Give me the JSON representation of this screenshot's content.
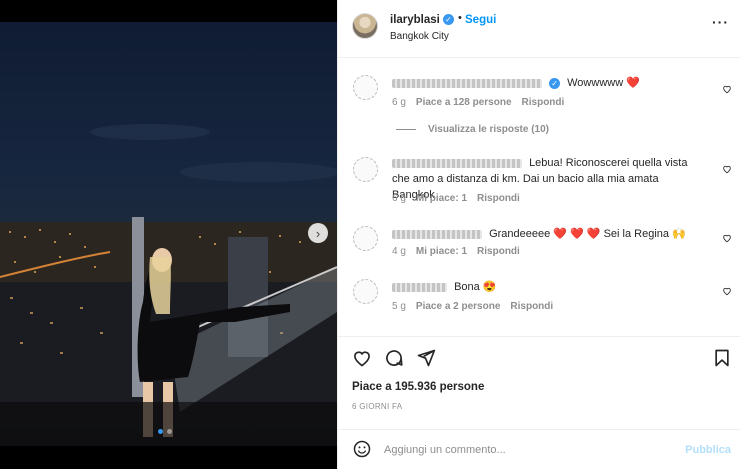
{
  "post": {
    "username": "ilaryblasi",
    "follow_label": "Segui",
    "location": "Bangkok City",
    "more_icon": "more-horizontal-icon",
    "verified_icon": "verified-badge-icon"
  },
  "comments": [
    {
      "text": "Wowwwww",
      "emoji": "❤️",
      "time": "6 g",
      "likes": "Piace a 128 persone",
      "reply": "Rispondi",
      "view_replies": "Visualizza le risposte (10)"
    },
    {
      "text": "Lebua! Riconoscerei quella vista che amo a distanza di km. Dai un bacio alla mia amata Bangkok",
      "time": "6 g",
      "likes": "Mi piace: 1",
      "reply": "Rispondi"
    },
    {
      "text": "Grandeeeee",
      "emoji": "❤️ ❤️ ❤️",
      "text_after": "Sei la Regina",
      "emoji_after": "🙌",
      "time": "4 g",
      "likes": "Mi piace: 1",
      "reply": "Rispondi"
    },
    {
      "text": "Bona",
      "emoji": "😍",
      "time": "5 g",
      "likes": "Piace a 2 persone",
      "reply": "Rispondi"
    }
  ],
  "actions": {
    "like_icon": "heart-icon",
    "comment_icon": "comment-icon",
    "share_icon": "share-icon",
    "save_icon": "bookmark-icon",
    "likes_text": "Piace a 195.936 persone",
    "time_ago": "6 GIORNI FA"
  },
  "add_comment": {
    "placeholder": "Aggiungi un commento...",
    "publish_label": "Pubblica",
    "emoji_icon": "emoji-icon"
  },
  "carousel": {
    "next_icon": "chevron-right-icon",
    "slides": 2,
    "active_slide": 1
  },
  "colors": {
    "accent": "#0095f6",
    "verified": "#3897f0",
    "muted": "#8e8e8e",
    "heart": "#ed4956",
    "publish_disabled": "#b2dffc"
  }
}
